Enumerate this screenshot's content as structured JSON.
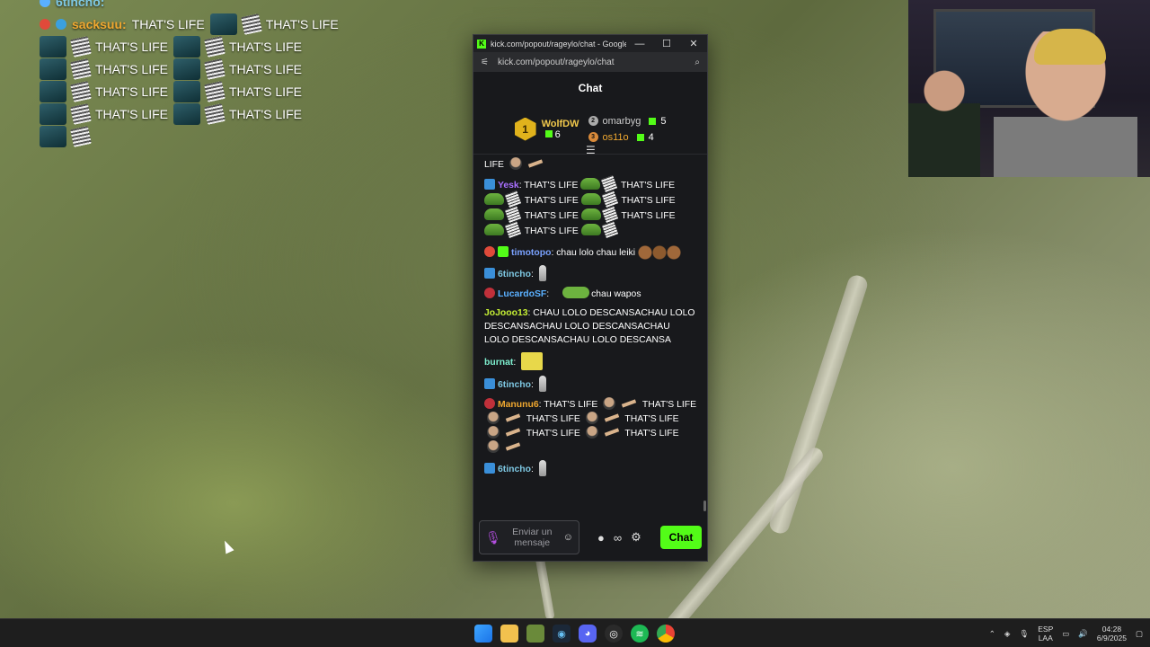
{
  "overlay": {
    "lines": [
      {
        "user": "6tincho:",
        "text": ""
      },
      {
        "user": "sacksuu:",
        "text": "THAT'S LIFE",
        "text2": "THAT'S LIFE"
      },
      {
        "text": "THAT'S LIFE",
        "text2": "THAT'S LIFE"
      },
      {
        "text": "THAT'S LIFE",
        "text2": "THAT'S LIFE"
      },
      {
        "text": "THAT'S LIFE",
        "text2": "THAT'S LIFE"
      },
      {
        "text": "THAT'S LIFE",
        "text2": "THAT'S LIFE"
      }
    ],
    "colors": {
      "user1": "#7ec8e3",
      "user2": "#f0a830"
    }
  },
  "window": {
    "title": "kick.com/popout/rageylo/chat - Google...",
    "url": "kick.com/popout/rageylo/chat",
    "controls": {
      "minimize": "—",
      "maximize": "☐",
      "close": "✕"
    }
  },
  "chat": {
    "header": "Chat",
    "leaderboard": {
      "first": {
        "rank": "1",
        "name": "WolfDW",
        "count": "6"
      },
      "second": {
        "rank": "2",
        "name": "omarbyg",
        "count": "5"
      },
      "third": {
        "rank": "3",
        "name": "os11o",
        "count": "4"
      }
    },
    "messages": [
      {
        "user": "",
        "text": "LIFE",
        "color": "#ffffff"
      },
      {
        "user": "Yesk",
        "text": "THAT'S LIFE",
        "color": "#a970ff"
      },
      {
        "user": "timotopo",
        "text": "chau lolo chau leiki",
        "color": "#7aa2ff"
      },
      {
        "user": "6tincho",
        "text": "",
        "color": "#7ec8e3"
      },
      {
        "user": "LucardoSF",
        "text": "chau wapos",
        "color": "#5ab0ff"
      },
      {
        "user": "JoJooo13",
        "text": "CHAU LOLO DESCANSACHAU LOLO DESCANSACHAU LOLO DESCANSACHAU LOLO DESCANSACHAU LOLO DESCANSA",
        "color": "#c6f035"
      },
      {
        "user": "burnat",
        "text": "",
        "color": "#7ef0d0"
      },
      {
        "user": "6tincho",
        "text": "",
        "color": "#7ec8e3"
      },
      {
        "user": "Manunu6",
        "text": "THAT'S LIFE",
        "color": "#f0a830"
      },
      {
        "user": "6tincho",
        "text": "",
        "color": "#7ec8e3"
      }
    ],
    "thats_life": "THAT'S LIFE",
    "input_placeholder": "Enviar un mensaje",
    "send_label": "Chat",
    "accent": "#53fc18"
  },
  "taskbar": {
    "lang_top": "ESP",
    "lang_bottom": "LAA",
    "time": "04:28",
    "date": "6/9/2025"
  }
}
